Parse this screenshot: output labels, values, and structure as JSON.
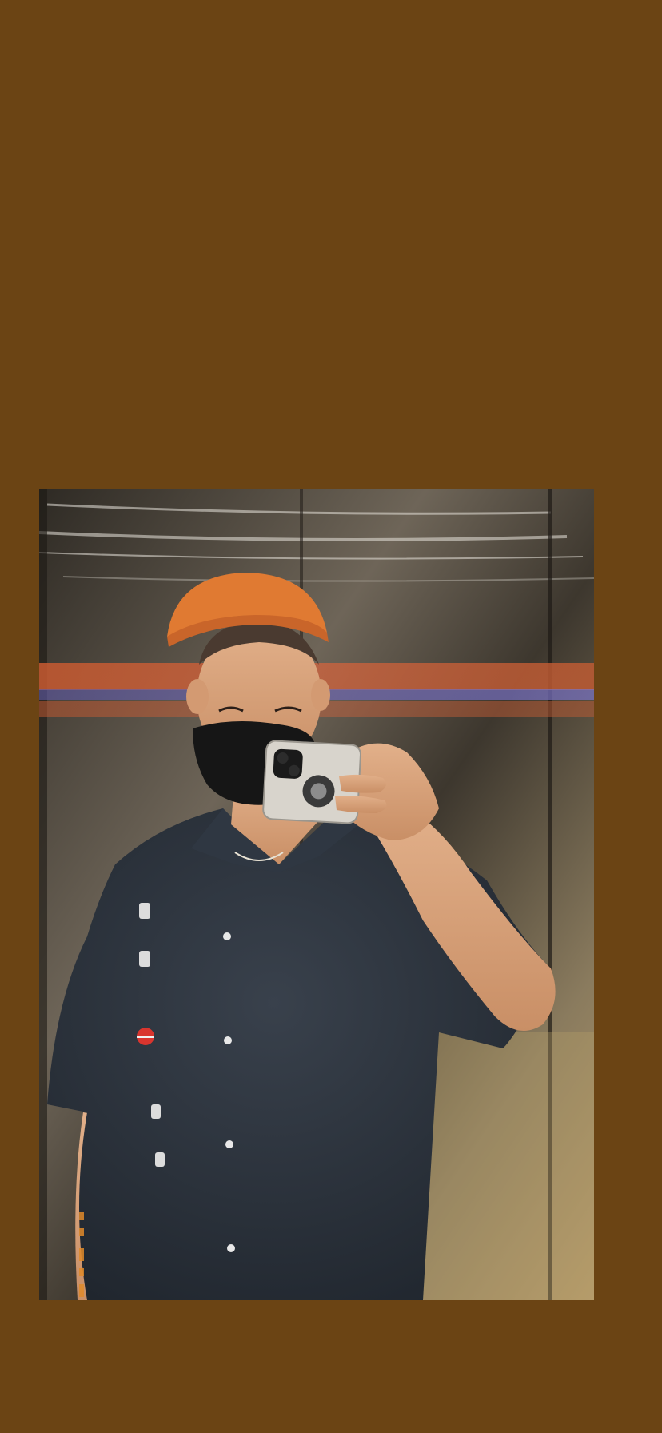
{
  "wallpaper": {
    "background_color": "#6B4414"
  },
  "photo": {
    "subject": "mirror-selfie-in-elevator",
    "colors": {
      "wall_dark": "#3A3328",
      "wall_light": "#B8AE9E",
      "beanie": "#E07A32",
      "shirt": "#2B323C",
      "mask": "#161616",
      "skin": "#D9A47A",
      "phone_case": "#D8D4CC",
      "stripe_orange": "#D9643C",
      "stripe_blue": "#6A66B8"
    }
  }
}
